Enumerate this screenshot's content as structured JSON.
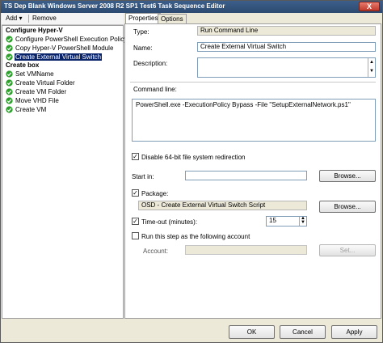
{
  "window": {
    "title": "TS Dep Blank Windows Server 2008 R2 SP1 Test6 Task Sequence Editor",
    "close_glyph": "X"
  },
  "toolbar": {
    "add_label": "Add",
    "add_arrow": "▾",
    "remove_label": "Remove"
  },
  "tree": {
    "groups": [
      {
        "label": "Configure Hyper-V",
        "items": [
          "Configure PowerShell Execution Policy",
          "Copy Hyper-V PowerShell Module",
          "Create External Virtual Switch"
        ]
      },
      {
        "label": "Create box",
        "items": [
          "Set VMName",
          "Create Virtual Folder",
          "Create VM Folder",
          "Move VHD File",
          "Create VM"
        ]
      }
    ],
    "selected": "Create External Virtual Switch"
  },
  "tabs": [
    "Properties",
    "Options"
  ],
  "properties": {
    "type_label": "Type:",
    "type_value": "Run Command Line",
    "name_label": "Name:",
    "name_value": "Create External Virtual Switch",
    "description_label": "Description:",
    "description_value": "",
    "command_line_label": "Command line:",
    "command_line_value": "PowerShell.exe -ExecutionPolicy Bypass -File \"SetupExternalNetwork.ps1\"",
    "disable_redirection_label": "Disable 64-bit file system redirection",
    "disable_redirection_checked": true,
    "start_in_label": "Start in:",
    "start_in_value": "",
    "browse_label": "Browse...",
    "package_label": "Package:",
    "package_checked": true,
    "package_value": "OSD - Create External Virtual Switch Script",
    "timeout_label": "Time-out (minutes):",
    "timeout_checked": true,
    "timeout_value": "15",
    "run_as_label": "Run this step as the following account",
    "run_as_checked": false,
    "account_label": "Account:",
    "account_value": "",
    "set_label": "Set..."
  },
  "buttons": {
    "ok": "OK",
    "cancel": "Cancel",
    "apply": "Apply"
  },
  "colors": {
    "selection": "#0a246a",
    "check_green": "#2e9e2e"
  }
}
